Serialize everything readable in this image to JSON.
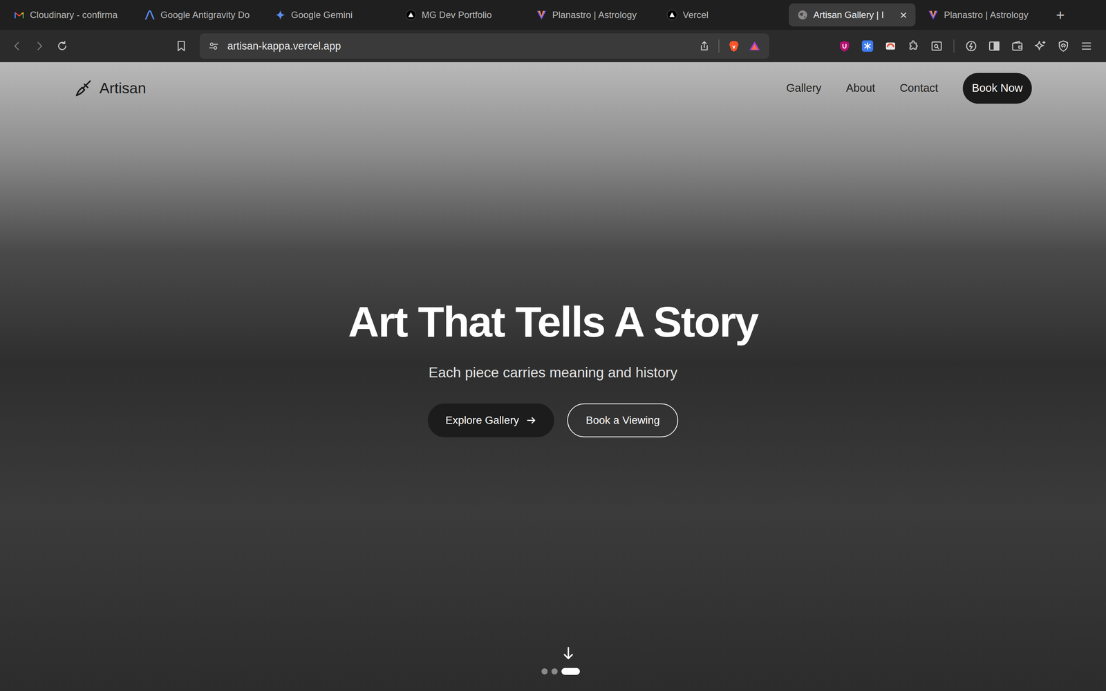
{
  "browser": {
    "tabs": [
      {
        "label": "Cloudinary - confirma",
        "kind": "gmail",
        "selected": false
      },
      {
        "label": "Google Antigravity Do",
        "kind": "antigravity",
        "selected": false
      },
      {
        "label": "Google Gemini",
        "kind": "gemini",
        "selected": false
      },
      {
        "label": "MG Dev Portfolio",
        "kind": "vercel",
        "selected": false
      },
      {
        "label": "Planastro | Astrology",
        "kind": "planastro",
        "selected": false
      },
      {
        "label": "Vercel",
        "kind": "vercel",
        "selected": false
      },
      {
        "label": "Artisan Gallery | I",
        "kind": "globe",
        "selected": true,
        "close": "×"
      },
      {
        "label": "Planastro | Astrology",
        "kind": "planastro",
        "selected": false
      }
    ],
    "new_tab": "+",
    "address": "artisan-kappa.vercel.app"
  },
  "site": {
    "logo": "Artisan",
    "nav": [
      "Gallery",
      "About",
      "Contact"
    ],
    "cta": "Book Now",
    "hero": {
      "title": "Art That Tells A Story",
      "subtitle": "Each piece carries meaning and history",
      "buttons": [
        {
          "label": "Explore Gallery",
          "kind": "primary"
        },
        {
          "label": "Book a Viewing",
          "kind": "outline"
        }
      ]
    },
    "slides": [
      {
        "selected": false
      },
      {
        "selected": false
      },
      {
        "selected": true
      }
    ]
  }
}
